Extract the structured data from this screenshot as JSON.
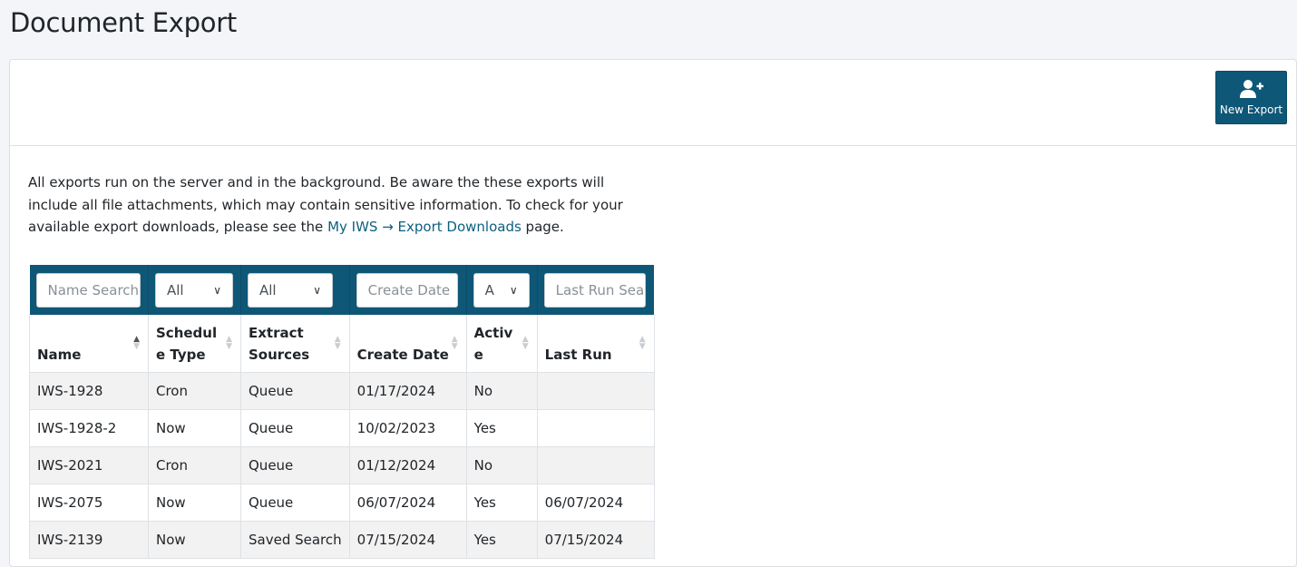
{
  "page": {
    "title": "Document Export"
  },
  "header": {
    "new_export_label": "New Export"
  },
  "info": {
    "text_before_link": "All exports run on the server and in the background. Be aware the these exports will include all file attachments, which may contain sensitive information. To check for your available export downloads, please see the ",
    "link_text": "My IWS → Export Downloads",
    "text_after_link": " page."
  },
  "filters": {
    "name_placeholder": "Name Search",
    "schedule_type_value": "All",
    "extract_sources_value": "All",
    "create_date_placeholder": "Create Date",
    "active_value": "A",
    "last_run_placeholder": "Last Run Search"
  },
  "table": {
    "headers": {
      "name": "Name",
      "schedule_type_1": "Schedul",
      "schedule_type_2": "e Type",
      "extract_sources_1": "Extract",
      "extract_sources_2": "Sources",
      "create_date": "Create Date",
      "active_1": "Activ",
      "active_2": "e",
      "last_run": "Last Run"
    },
    "rows": [
      {
        "name": "IWS-1928",
        "schedule_type": "Cron",
        "extract_sources": "Queue",
        "create_date": "01/17/2024",
        "active": "No",
        "last_run": ""
      },
      {
        "name": "IWS-1928-2",
        "schedule_type": "Now",
        "extract_sources": "Queue",
        "create_date": "10/02/2023",
        "active": "Yes",
        "last_run": ""
      },
      {
        "name": "IWS-2021",
        "schedule_type": "Cron",
        "extract_sources": "Queue",
        "create_date": "01/12/2024",
        "active": "No",
        "last_run": ""
      },
      {
        "name": "IWS-2075",
        "schedule_type": "Now",
        "extract_sources": "Queue",
        "create_date": "06/07/2024",
        "active": "Yes",
        "last_run": "06/07/2024"
      },
      {
        "name": "IWS-2139",
        "schedule_type": "Now",
        "extract_sources": "Saved Search",
        "create_date": "07/15/2024",
        "active": "Yes",
        "last_run": "07/15/2024"
      }
    ]
  },
  "colors": {
    "accent": "#0e5777",
    "link": "#0d6080",
    "stripe": "#f2f2f2"
  },
  "icons": {
    "new_export": "user-plus-icon",
    "sort": "sort-icon"
  }
}
